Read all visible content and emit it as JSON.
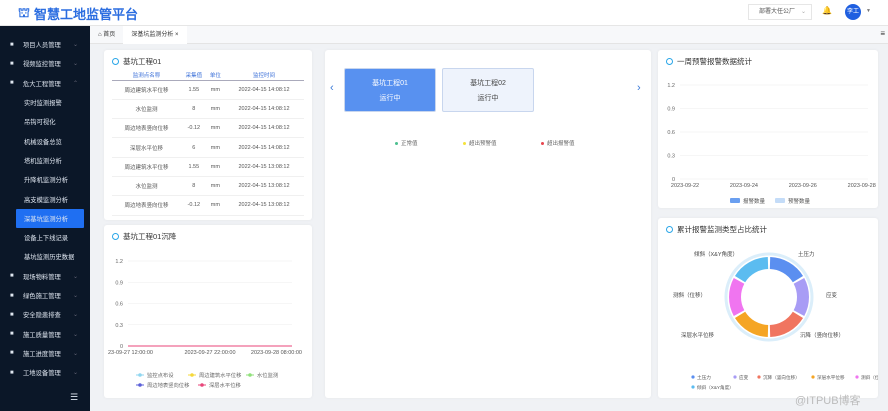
{
  "header": {
    "title": "智慧工地监管平台",
    "org_select": "部署大任公厂",
    "user": "李工"
  },
  "sidebar": {
    "items": [
      {
        "label": "项目人员管理",
        "icon": "user-icon",
        "expanded": false
      },
      {
        "label": "视频监控管理",
        "icon": "video-icon",
        "expanded": false
      },
      {
        "label": "危大工程管理",
        "icon": "building-icon",
        "expanded": true,
        "children": [
          "实时监测报警",
          "吊钩可视化",
          "机械设备总览",
          "塔机监测分析",
          "升降机监测分析",
          "高支模监测分析",
          "深基坑监测分析",
          "设备上下线记录",
          "基坑监测历史数据"
        ],
        "active": "深基坑监测分析"
      },
      {
        "label": "现场物料管理",
        "icon": "box-icon",
        "expanded": false
      },
      {
        "label": "绿色施工管理",
        "icon": "leaf-icon",
        "expanded": false
      },
      {
        "label": "安全隐患排查",
        "icon": "shield-icon",
        "expanded": false
      },
      {
        "label": "施工质量管理",
        "icon": "check-icon",
        "expanded": false
      },
      {
        "label": "施工进度管理",
        "icon": "progress-icon",
        "expanded": false
      },
      {
        "label": "工地设备管理",
        "icon": "device-icon",
        "expanded": false
      }
    ]
  },
  "tabs": [
    {
      "label": "首页"
    },
    {
      "label": "深基坑监测分析"
    }
  ],
  "table_card": {
    "title": "基坑工程01",
    "columns": [
      "监测点名称",
      "采集值",
      "单位",
      "监控时间"
    ],
    "rows": [
      [
        "周边建筑水平位移",
        "1.55",
        "mm",
        "2022-04-15 14:08:12"
      ],
      [
        "水位监测",
        "8",
        "mm",
        "2022-04-15 14:08:12"
      ],
      [
        "周边地表竖向位移",
        "-0.12",
        "mm",
        "2022-04-15 14:08:12"
      ],
      [
        "深层水平位移",
        "6",
        "mm",
        "2022-04-15 14:08:12"
      ],
      [
        "周边建筑水平位移",
        "1.55",
        "mm",
        "2022-04-15 13:08:12"
      ],
      [
        "水位监测",
        "8",
        "mm",
        "2022-04-15 13:08:12"
      ],
      [
        "周边地表竖向位移",
        "-0.12",
        "mm",
        "2022-04-15 13:08:12"
      ]
    ]
  },
  "center": {
    "projects": [
      {
        "name": "基坑工程01",
        "status": "运行中",
        "active": true
      },
      {
        "name": "基坑工程02",
        "status": "运行中",
        "active": false
      }
    ],
    "legend": [
      {
        "label": "正常值",
        "color": "#4cbf8f"
      },
      {
        "label": "超出预警值",
        "color": "#f5e23a"
      },
      {
        "label": "超出报警值",
        "color": "#e8464f"
      }
    ]
  },
  "chart_data": [
    {
      "type": "line",
      "title": "基坑工程01沉降",
      "x": [
        "23-09-27 12:00:00",
        "2023-09-27 22:00:00",
        "2023-09-28 08:00:00"
      ],
      "yticks": [
        "0",
        "0.3",
        "0.6",
        "0.9",
        "1.2"
      ],
      "ylim": [
        0,
        1.2
      ],
      "series": [
        {
          "name": "监控点布设",
          "color": "#8fd6f0",
          "values": [
            0,
            0,
            0
          ]
        },
        {
          "name": "周边建筑水平位移",
          "color": "#f5d83a",
          "values": [
            0,
            0,
            0
          ]
        },
        {
          "name": "水位监测",
          "color": "#8fe07a",
          "values": [
            0,
            0,
            0
          ]
        },
        {
          "name": "周边地表竖向位移",
          "color": "#5a5fd8",
          "values": [
            0,
            0,
            0
          ]
        },
        {
          "name": "深层水平位移",
          "color": "#e8467a",
          "values": [
            0,
            0,
            0
          ]
        }
      ]
    },
    {
      "type": "bar",
      "title": "一周预警报警数据统计",
      "categories": [
        "2023-09-22",
        "2023-09-24",
        "2023-09-26",
        "2023-09-28"
      ],
      "yticks": [
        "0",
        "0.3",
        "0.6",
        "0.9",
        "1.2"
      ],
      "ylim": [
        0,
        1.2
      ],
      "series": [
        {
          "name": "报警数量",
          "color": "#6a9ff0",
          "values": [
            0,
            0,
            0,
            0
          ]
        },
        {
          "name": "预警数量",
          "color": "#c4dcf8",
          "values": [
            0,
            0,
            0,
            0
          ]
        }
      ]
    },
    {
      "type": "pie",
      "title": "累计报警监测类型占比统计",
      "labels": [
        "土压力",
        "应变",
        "沉降（竖向位移）",
        "深层水平位移",
        "测斜（位移）",
        "倾斜（X&Y角度）"
      ],
      "values": [
        1,
        1,
        1,
        1,
        1,
        1
      ],
      "colors": [
        "#5b8ff0",
        "#a89cf5",
        "#f07560",
        "#f5a524",
        "#f075f0",
        "#5bbcf0"
      ]
    }
  ],
  "watermark": "@ITPUB博客"
}
